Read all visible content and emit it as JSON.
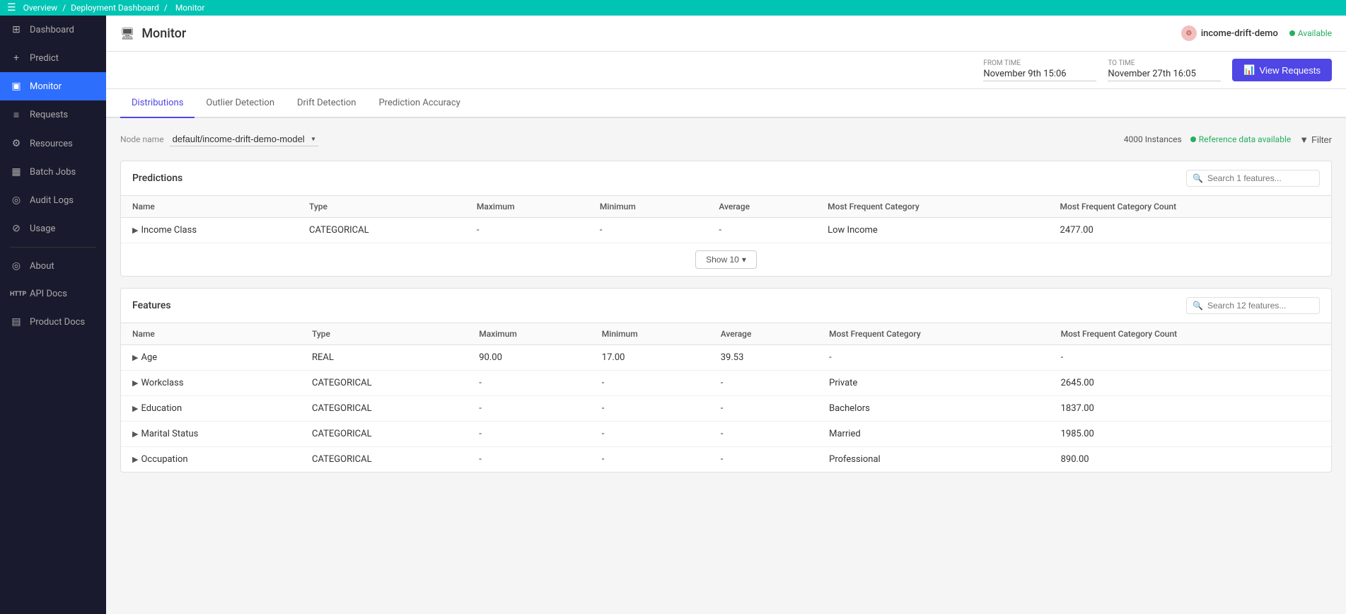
{
  "topbar": {
    "breadcrumb": [
      "Overview",
      "Deployment Dashboard",
      "Monitor"
    ]
  },
  "sidebar": {
    "items": [
      {
        "id": "dashboard",
        "label": "Dashboard",
        "icon": "⊞"
      },
      {
        "id": "predict",
        "label": "Predict",
        "icon": "+"
      },
      {
        "id": "monitor",
        "label": "Monitor",
        "icon": "▣",
        "active": true
      },
      {
        "id": "requests",
        "label": "Requests",
        "icon": "≡"
      },
      {
        "id": "resources",
        "label": "Resources",
        "icon": "⚙"
      },
      {
        "id": "batch-jobs",
        "label": "Batch Jobs",
        "icon": "▦"
      },
      {
        "id": "audit-logs",
        "label": "Audit Logs",
        "icon": "◎"
      },
      {
        "id": "usage",
        "label": "Usage",
        "icon": "⊘"
      }
    ],
    "bottom_items": [
      {
        "id": "about",
        "label": "About",
        "icon": "◎"
      },
      {
        "id": "api-docs",
        "label": "API Docs",
        "icon": "HTTP"
      },
      {
        "id": "product-docs",
        "label": "Product Docs",
        "icon": "▤"
      }
    ]
  },
  "page": {
    "title": "Monitor",
    "title_icon": "🖥"
  },
  "model": {
    "name": "income-drift-demo",
    "status": "Available"
  },
  "time": {
    "from_label": "From Time",
    "from_value": "November 9th 15:06",
    "to_label": "To Time",
    "to_value": "November 27th 16:05",
    "view_requests_label": "View Requests"
  },
  "tabs": [
    {
      "id": "distributions",
      "label": "Distributions",
      "active": true
    },
    {
      "id": "outlier-detection",
      "label": "Outlier Detection"
    },
    {
      "id": "drift-detection",
      "label": "Drift Detection"
    },
    {
      "id": "prediction-accuracy",
      "label": "Prediction Accuracy"
    }
  ],
  "node": {
    "label": "Node name",
    "value": "default/income-drift-demo-model"
  },
  "instances": {
    "count": "4000 Instances",
    "ref_badge": "Reference data available"
  },
  "predictions_table": {
    "title": "Predictions",
    "search_placeholder": "Search 1 features...",
    "columns": [
      "Name",
      "Type",
      "Maximum",
      "Minimum",
      "Average",
      "Most Frequent Category",
      "Most Frequent Category Count"
    ],
    "rows": [
      {
        "name": "Income Class",
        "type": "CATEGORICAL",
        "maximum": "-",
        "minimum": "-",
        "average": "-",
        "most_frequent_category": "Low Income",
        "most_frequent_category_count": "2477.00"
      }
    ],
    "show_more_label": "Show 10"
  },
  "features_table": {
    "title": "Features",
    "search_placeholder": "Search 12 features...",
    "columns": [
      "Name",
      "Type",
      "Maximum",
      "Minimum",
      "Average",
      "Most Frequent Category",
      "Most Frequent Category Count"
    ],
    "rows": [
      {
        "name": "Age",
        "type": "REAL",
        "maximum": "90.00",
        "minimum": "17.00",
        "average": "39.53",
        "most_frequent_category": "-",
        "most_frequent_category_count": "-"
      },
      {
        "name": "Workclass",
        "type": "CATEGORICAL",
        "maximum": "-",
        "minimum": "-",
        "average": "-",
        "most_frequent_category": "Private",
        "most_frequent_category_count": "2645.00"
      },
      {
        "name": "Education",
        "type": "CATEGORICAL",
        "maximum": "-",
        "minimum": "-",
        "average": "-",
        "most_frequent_category": "Bachelors",
        "most_frequent_category_count": "1837.00"
      },
      {
        "name": "Marital Status",
        "type": "CATEGORICAL",
        "maximum": "-",
        "minimum": "-",
        "average": "-",
        "most_frequent_category": "Married",
        "most_frequent_category_count": "1985.00"
      },
      {
        "name": "Occupation",
        "type": "CATEGORICAL",
        "maximum": "-",
        "minimum": "-",
        "average": "-",
        "most_frequent_category": "Professional",
        "most_frequent_category_count": "890.00"
      }
    ]
  }
}
